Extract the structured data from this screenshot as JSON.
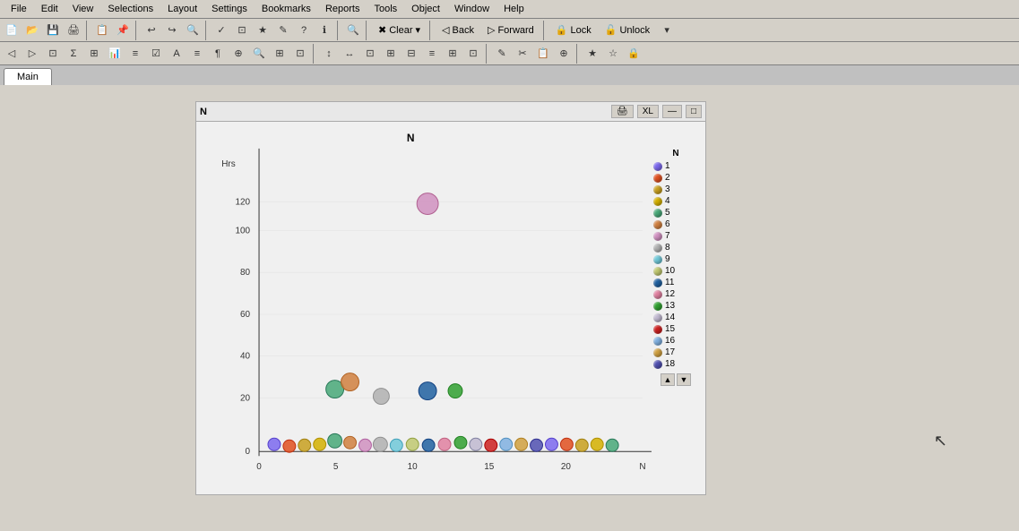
{
  "menubar": {
    "items": [
      "File",
      "Edit",
      "View",
      "Selections",
      "Layout",
      "Settings",
      "Bookmarks",
      "Reports",
      "Tools",
      "Object",
      "Window",
      "Help"
    ]
  },
  "toolbar1": {
    "clear_label": "Clear",
    "back_label": "Back",
    "forward_label": "Forward",
    "lock_label": "Lock",
    "unlock_label": "Unlock"
  },
  "tabs": {
    "main_label": "Main"
  },
  "chart": {
    "title": "N",
    "chart_title": "N",
    "x_label": "N",
    "y_label": "Hrs",
    "icon_print": "🖨",
    "icon_xl": "XL",
    "icon_minimize": "—",
    "icon_maximize": "□",
    "legend_title": "N",
    "legend_items": [
      {
        "num": "1",
        "color": "#7b68ee"
      },
      {
        "num": "2",
        "color": "#e05020"
      },
      {
        "num": "3",
        "color": "#c8a020"
      },
      {
        "num": "4",
        "color": "#d4b000"
      },
      {
        "num": "5",
        "color": "#48a878"
      },
      {
        "num": "6",
        "color": "#d08040"
      },
      {
        "num": "7",
        "color": "#d090c0"
      },
      {
        "num": "8",
        "color": "#b0b0b0"
      },
      {
        "num": "9",
        "color": "#70c8d8"
      },
      {
        "num": "10",
        "color": "#c0c870"
      },
      {
        "num": "11",
        "color": "#2060a0"
      },
      {
        "num": "12",
        "color": "#e080a0"
      },
      {
        "num": "13",
        "color": "#30a030"
      },
      {
        "num": "14",
        "color": "#c0b8d0"
      },
      {
        "num": "15",
        "color": "#cc2020"
      },
      {
        "num": "16",
        "color": "#80b0e0"
      },
      {
        "num": "17",
        "color": "#d0a040"
      },
      {
        "num": "18",
        "color": "#5050b0"
      }
    ],
    "y_axis": [
      "120",
      "100",
      "80",
      "60",
      "40",
      "20",
      "0"
    ],
    "x_axis": [
      "0",
      "5",
      "10",
      "15",
      "20"
    ]
  },
  "cursor": "default"
}
